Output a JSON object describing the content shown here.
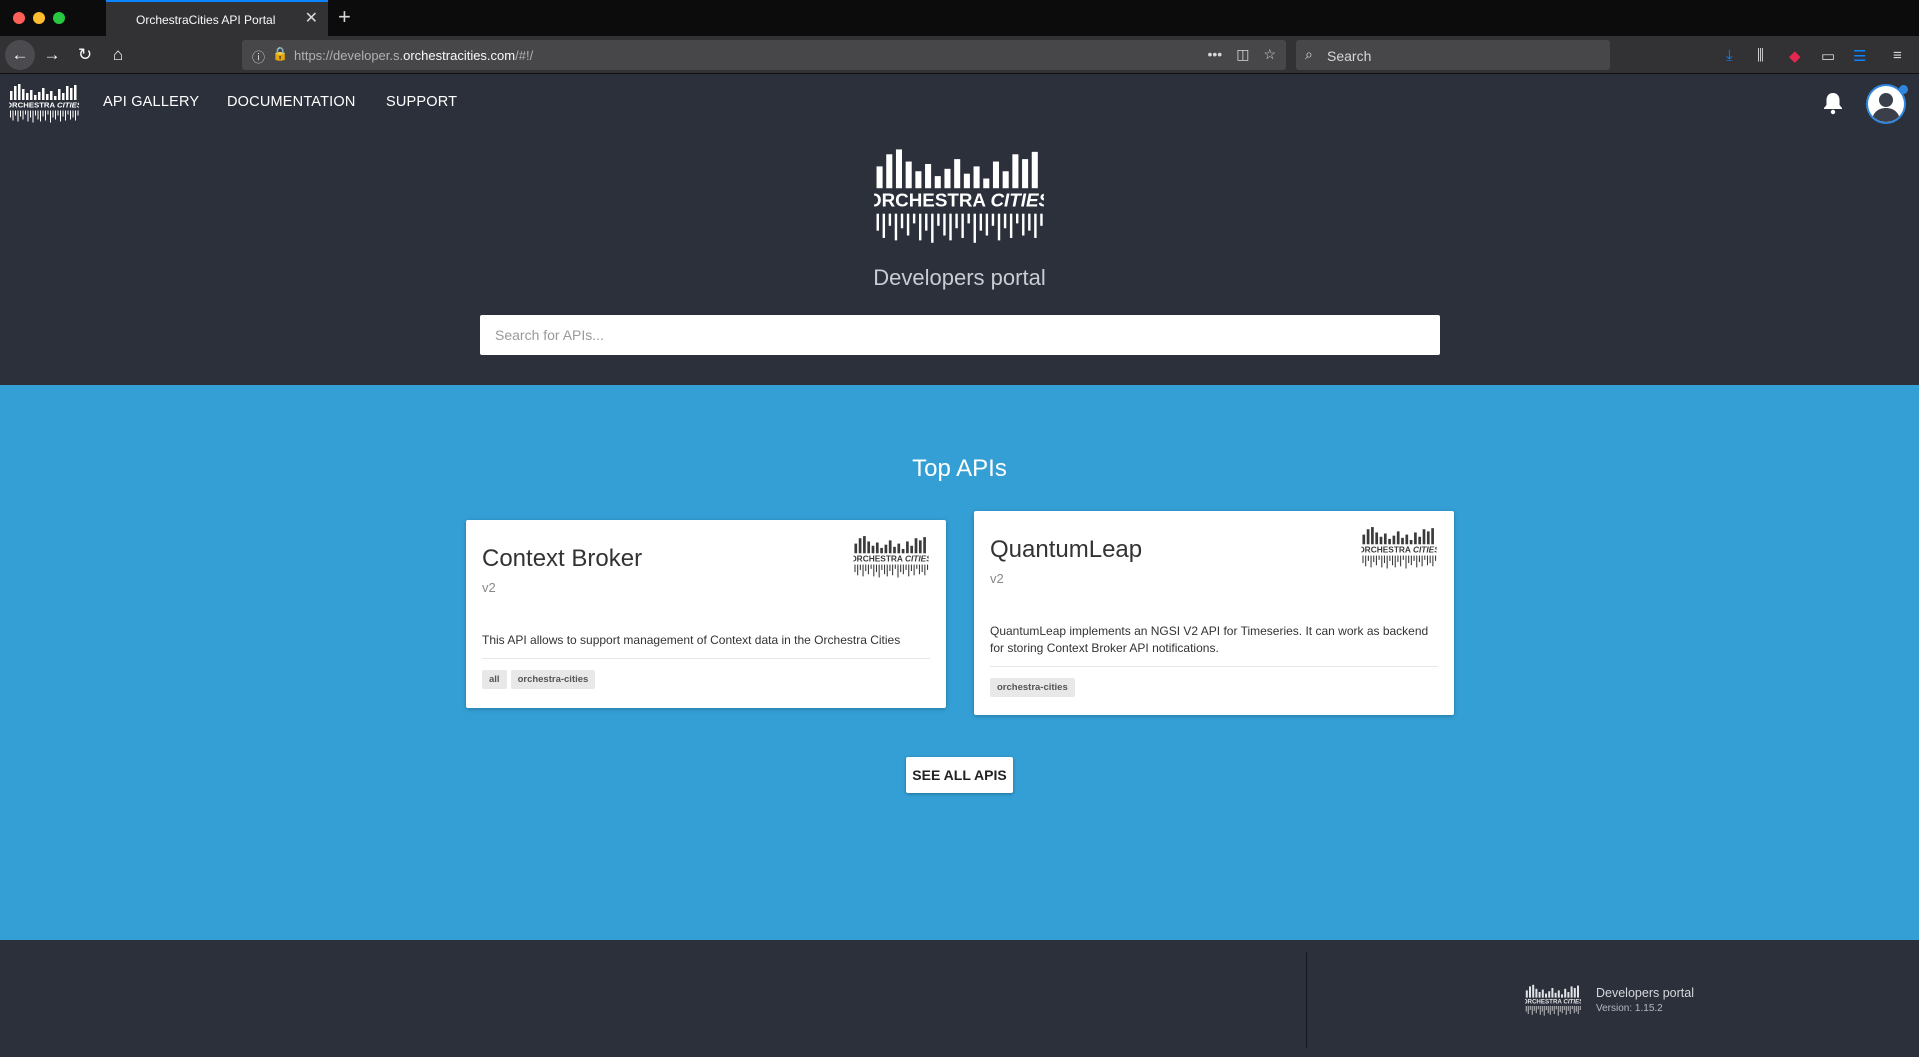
{
  "browser": {
    "tab_title": "OrchestraCities API Portal",
    "url_prefix": "https://developer.s.",
    "url_domain": "orchestracities.com",
    "url_suffix": "/#!/",
    "search_placeholder": "Search",
    "icons": [
      "back-icon",
      "forward-icon",
      "reload-icon",
      "home-icon",
      "info-icon",
      "lock-icon",
      "more-icon",
      "pocket-icon",
      "star-icon",
      "search-icon",
      "download-icon",
      "library-icon",
      "extension-icon",
      "sidebar-icon",
      "reader-icon",
      "menu-icon"
    ]
  },
  "header": {
    "nav": [
      "API GALLERY",
      "DOCUMENTATION",
      "SUPPORT"
    ],
    "logo_text": "ORCHESTRA CITIES",
    "subtitle": "Developers portal",
    "search_placeholder": "Search for APIs..."
  },
  "main": {
    "section_title": "Top APIs",
    "cards": [
      {
        "title": "Context Broker",
        "version": "v2",
        "description": "This API allows to support management of Context data in the Orchestra Cities",
        "tags": [
          "all",
          "orchestra-cities"
        ]
      },
      {
        "title": "QuantumLeap",
        "version": "v2",
        "description": "QuantumLeap implements an NGSI V2 API for Timeseries. It can work as backend for storing Context Broker API notifications.",
        "tags": [
          "orchestra-cities"
        ]
      }
    ],
    "see_all_label": "SEE ALL APIS"
  },
  "footer": {
    "title": "Developers portal",
    "version": "Version: 1.15.2"
  },
  "colors": {
    "dark_bg": "#2c303b",
    "accent_blue": "#349fd5",
    "browser_accent": "#0a84ff"
  }
}
